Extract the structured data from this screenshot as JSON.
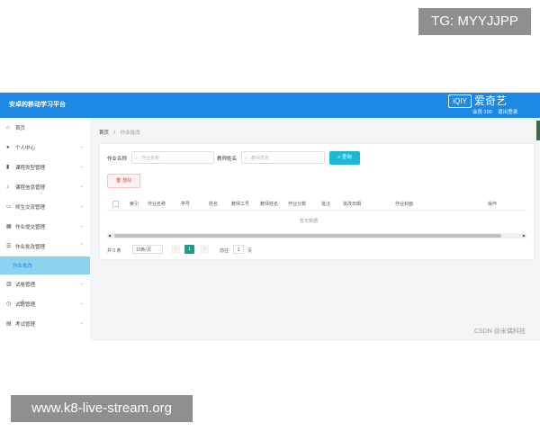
{
  "overlays": {
    "tg": "TG: MYYJJPP",
    "site": "www.k8-live-stream.org"
  },
  "header": {
    "app_title": "安卓的移动学习平台",
    "brand": {
      "logo": "iQIY",
      "name": "爱奇艺",
      "vip": "会员 100",
      "login": "退出登录"
    },
    "accent_color": "#1e88e5"
  },
  "sidebar": {
    "items": [
      {
        "label": "首页",
        "icon": "home-icon",
        "has_children": false
      },
      {
        "label": "个人中心",
        "icon": "user-icon",
        "has_children": true
      },
      {
        "label": "课程类型管理",
        "icon": "chart-icon",
        "has_children": true
      },
      {
        "label": "课程信息管理",
        "icon": "microphone-icon",
        "has_children": true
      },
      {
        "label": "师生交流管理",
        "icon": "folder-icon",
        "has_children": true
      },
      {
        "label": "作业提交管理",
        "icon": "grid-icon",
        "has_children": true
      },
      {
        "label": "作业批改管理",
        "icon": "list-icon",
        "has_children": true
      },
      {
        "label": "作业批改",
        "icon": "",
        "has_children": false,
        "active": true
      },
      {
        "label": "试卷管理",
        "icon": "barcode-icon",
        "has_children": true
      },
      {
        "label": "试题管理",
        "icon": "clock-icon",
        "has_children": true
      },
      {
        "label": "考试管理",
        "icon": "doc-icon",
        "has_children": true
      }
    ]
  },
  "breadcrumb": {
    "home": "首页",
    "separator": "/",
    "current": "作业批改"
  },
  "search": {
    "field1_label": "作业名称",
    "field1_placeholder": "作业名称",
    "field2_label": "教师姓名",
    "field2_placeholder": "教师姓名",
    "search_button": "查询"
  },
  "actions": {
    "delete_button": "删除"
  },
  "table": {
    "columns": [
      "索引",
      "作业名称",
      "学号",
      "姓名",
      "教师工号",
      "教师姓名",
      "作业分数",
      "批注",
      "批改日期",
      "作业封面",
      "操作"
    ],
    "empty_text": "暂无数据"
  },
  "pagination": {
    "total": "共 0 条",
    "page_size": "10条/页",
    "current_page": "1",
    "goto_label": "前往",
    "goto_value": "1",
    "page_suffix": "页"
  },
  "watermark": "CSDN @米偶科技"
}
